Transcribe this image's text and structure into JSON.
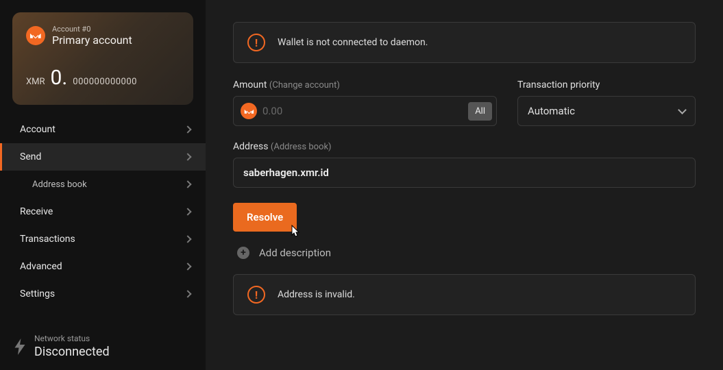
{
  "card": {
    "account_number": "Account #0",
    "account_name": "Primary account",
    "currency": "XMR",
    "balance_int": "0.",
    "balance_frac": "000000000000"
  },
  "menu": {
    "account": "Account",
    "send": "Send",
    "address_book": "Address book",
    "receive": "Receive",
    "transactions": "Transactions",
    "advanced": "Advanced",
    "settings": "Settings"
  },
  "network": {
    "label": "Network status",
    "status": "Disconnected"
  },
  "alert_daemon": "Wallet is not connected to daemon.",
  "amount": {
    "label": "Amount",
    "hint": "(Change account)",
    "placeholder": "0.00",
    "all_button": "All"
  },
  "priority": {
    "label": "Transaction priority",
    "selected": "Automatic"
  },
  "address": {
    "label": "Address",
    "hint": "(Address book)",
    "value": "saberhagen.xmr.id"
  },
  "resolve_button": "Resolve",
  "add_description": "Add description",
  "alert_invalid": "Address is invalid."
}
